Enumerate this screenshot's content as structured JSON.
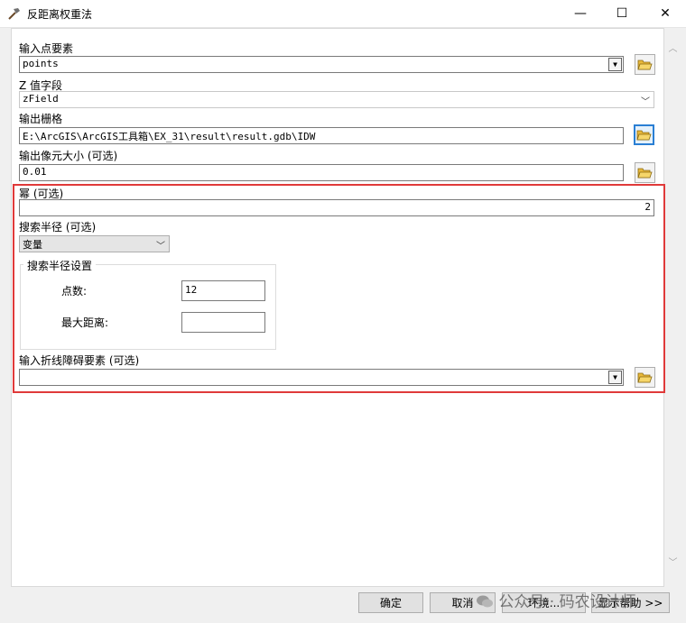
{
  "window": {
    "title": "反距离权重法",
    "minimize": "—",
    "maximize": "☐",
    "close": "✕"
  },
  "fields": {
    "input_points_label": "输入点要素",
    "input_points_value": "points",
    "z_field_label": "Z 值字段",
    "z_field_value": "zField",
    "output_raster_label": "输出栅格",
    "output_raster_value": "E:\\ArcGIS\\ArcGIS工具箱\\EX_31\\result\\result.gdb\\IDW",
    "cell_size_label": "输出像元大小 (可选)",
    "cell_size_value": "0.01",
    "power_label": "幂 (可选)",
    "power_value": "2",
    "search_radius_label": "搜索半径 (可选)",
    "search_radius_value": "变量",
    "radius_settings_title": "搜索半径设置",
    "points_label": "点数:",
    "points_value": "12",
    "max_distance_label": "最大距离:",
    "max_distance_value": "",
    "barrier_label": "输入折线障碍要素 (可选)",
    "barrier_value": ""
  },
  "footer": {
    "ok": "确定",
    "cancel": "取消",
    "environments": "环境...",
    "show_help": "显示帮助 >>"
  },
  "watermark": "公众号 · 码农设计师",
  "colors": {
    "highlight": "#e03a3a",
    "active_button": "#2a7fd4",
    "folder_yellow": "#e8b83a"
  }
}
